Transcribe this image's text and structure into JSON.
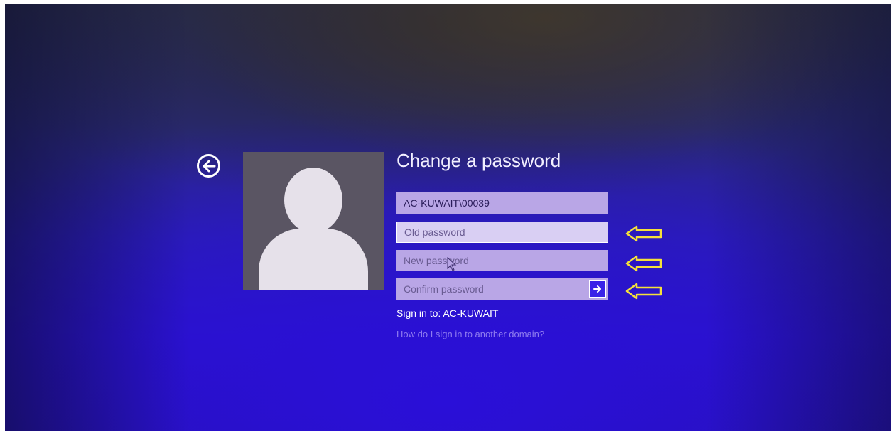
{
  "window": {
    "title": "Change a password"
  },
  "back_button": {
    "icon": "arrow-left-circle-icon"
  },
  "avatar": {
    "icon": "user-silhouette-icon"
  },
  "form": {
    "account_value": "AC-KUWAIT\\00039",
    "old_password_placeholder": "Old password",
    "new_password_placeholder": "New password",
    "confirm_password_placeholder": "Confirm password",
    "submit_icon": "arrow-right-icon"
  },
  "sign_in_to": "Sign in to: AC-KUWAIT",
  "domain_link": "How do I sign in to another domain?",
  "annotations": {
    "arrow_color": "#f5e13a",
    "arrow_icon": "outlined-left-arrow-icon"
  },
  "colors": {
    "background": "#2a14c8",
    "accent": "#3a22e8",
    "field": "#b9a6e6",
    "link": "#8f7cf0"
  }
}
